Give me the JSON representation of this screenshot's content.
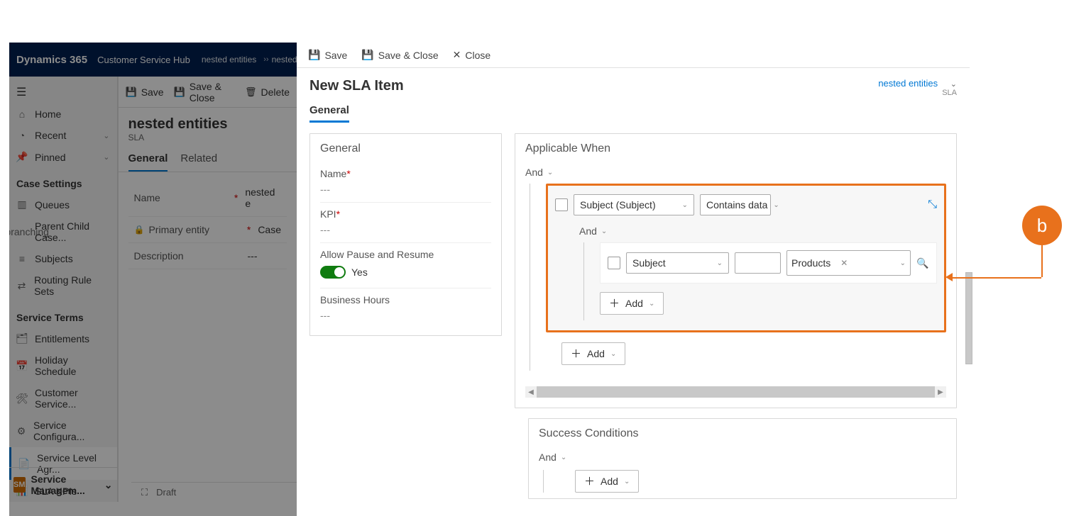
{
  "annotation": {
    "label": "b"
  },
  "bg": {
    "app_name": "Dynamics 365",
    "hub_name": "Customer Service Hub",
    "breadcrumb": [
      "nested entities",
      "nested entities"
    ],
    "cmd": {
      "save": "Save",
      "save_close": "Save & Close",
      "delete": "Delete"
    },
    "page_title": "nested entities",
    "page_subtitle": "SLA",
    "tabs": {
      "general": "General",
      "related": "Related"
    },
    "fields": {
      "name_label": "Name",
      "name_value": "nested e",
      "primary_label": "Primary entity",
      "primary_value": "Case",
      "desc_label": "Description",
      "desc_value": "---"
    },
    "nav": {
      "home": "Home",
      "recent": "Recent",
      "pinned": "Pinned",
      "sec_case": "Case Settings",
      "queues": "Queues",
      "parent_child": "Parent Child Case...",
      "subjects": "Subjects",
      "routing": "Routing Rule Sets",
      "sec_terms": "Service Terms",
      "entitlements": "Entitlements",
      "holiday": "Holiday Schedule",
      "cust_serv": "Customer Service...",
      "serv_conf": "Service Configura...",
      "sla": "Service Level Agr...",
      "sla_kpi": "SLA KPIs",
      "sm_badge": "SM",
      "service_mgmt": "Service Managem..."
    },
    "status": {
      "draft": "Draft"
    }
  },
  "fg": {
    "cmd": {
      "save": "Save",
      "save_close": "Save & Close",
      "close": "Close"
    },
    "title": "New SLA Item",
    "header_link": "nested entities",
    "header_sub": "SLA",
    "tab_general": "General",
    "general": {
      "section_title": "General",
      "name_label": "Name",
      "name_value": "---",
      "kpi_label": "KPI",
      "kpi_value": "---",
      "allow_label": "Allow Pause and Resume",
      "allow_value": "Yes",
      "bh_label": "Business Hours",
      "bh_value": "---"
    },
    "applicable": {
      "title": "Applicable When",
      "root_group": "And",
      "row1_field": "Subject (Subject)",
      "row1_op": "Contains data",
      "inner_group": "And",
      "row2_field": "Subject",
      "row2_value_tag": "Products",
      "add_label": "Add"
    },
    "success": {
      "title": "Success Conditions",
      "root_group": "And",
      "add_label": "Add"
    }
  }
}
